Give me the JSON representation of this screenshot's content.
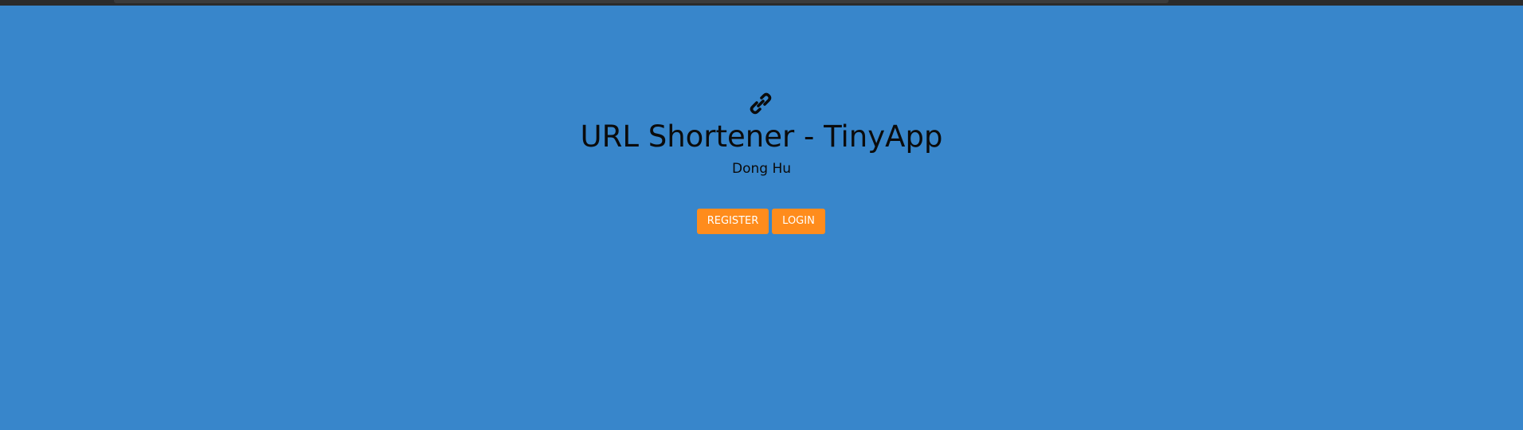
{
  "page": {
    "background_color": "#3886cb"
  },
  "header": {
    "icon": "link-icon",
    "title": "URL Shortener - TinyApp",
    "author": "Dong Hu"
  },
  "actions": {
    "register_label": "REGISTER",
    "login_label": "LOGIN",
    "button_color": "#ff8c1c"
  }
}
